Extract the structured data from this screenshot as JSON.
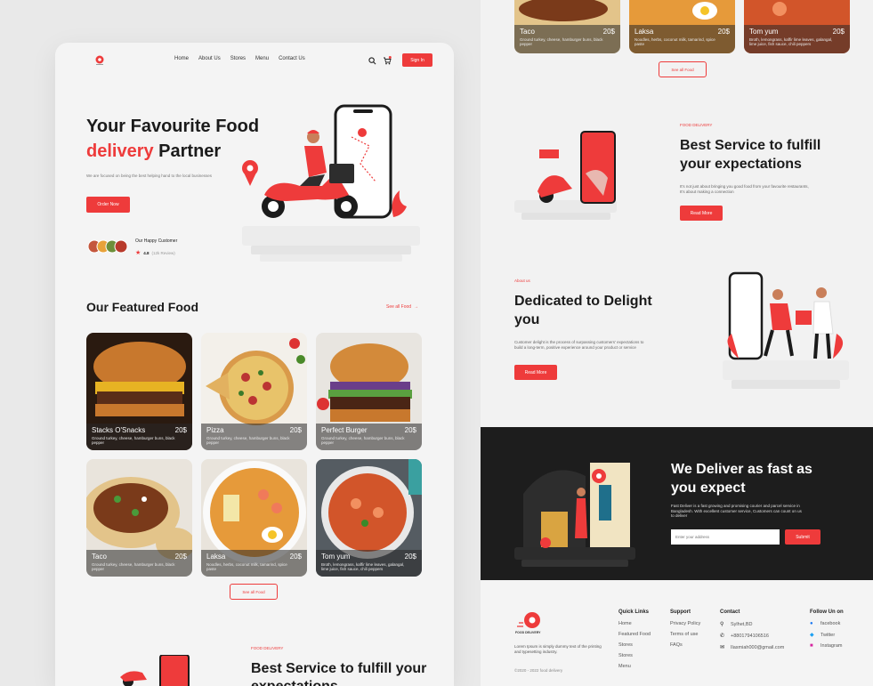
{
  "nav": {
    "links": [
      "Home",
      "About Us",
      "Stores",
      "Menu",
      "Contact Us"
    ],
    "signin": "Sign In"
  },
  "hero": {
    "title_line1": "Your Favourite Food",
    "title_red": "delivery",
    "title_rest": " Partner",
    "subtitle": "We are focused on being the best helping hand to the local businesses",
    "order_button": "Order Now",
    "customers_label": "Our Happy Customer",
    "rating": "4.8",
    "reviews": "(12k Review)"
  },
  "featured": {
    "title": "Our Featured Food",
    "see_all": "See all Food",
    "see_all_button": "See all Food",
    "items": [
      {
        "name": "Stacks O'Snacks",
        "price": "20$",
        "desc": "Ground turkey, cheese, hamburger buns, black pepper"
      },
      {
        "name": "Pizza",
        "price": "20$",
        "desc": "Ground turkey, cheese, hamburger buns, black pepper"
      },
      {
        "name": "Perfect Burger",
        "price": "20$",
        "desc": "Ground turkey, cheese, hamburger buns, black pepper"
      },
      {
        "name": "Taco",
        "price": "20$",
        "desc": "Ground turkey, cheese, hamburger buns, black pepper"
      },
      {
        "name": "Laksa",
        "price": "20$",
        "desc": "Noodles, herbs, coconut milk, tamarind, spice paste"
      },
      {
        "name": "Tom yum",
        "price": "20$",
        "desc": "Broth, lemongrass, kaffir lime leaves, galangal, lime juice, fish sauce, chili peppers"
      }
    ]
  },
  "left_service": {
    "tag": "FOOD DELIVERY",
    "title": "Best Service to fulfill your expectations"
  },
  "service": {
    "tag": "FOOD DELIVERY",
    "title": "Best Service to fulfill your expectations",
    "text": "It's not just about bringing you good food from your favourite restaurants, It's about making a connection",
    "button": "Read More"
  },
  "about": {
    "tag": "About us",
    "title": "Dedicated to Delight you",
    "text": "Customer delight is the process of surpassing customers' expectations to build a long-term, positive experience around your product or service",
    "button": "Read More"
  },
  "deliver": {
    "title": "We Deliver as fast as you expect",
    "text": "Fast Deliver is a fast growing and promising courier and parcel service in Bangladesh. With excellent customer service, Customers can count on us to deliver",
    "placeholder": "Enter your address",
    "submit": "Submit"
  },
  "footer": {
    "brand": "FOOD DELIVERY",
    "desc": "Lorem Ipsum is simply dummy text of the printing and typesetting industry.",
    "copyright": "©2020 - 2022 food delivery",
    "quick_links": {
      "head": "Quick Links",
      "items": [
        "Home",
        "Featured Food",
        "Stores",
        "Stores",
        "Menu"
      ]
    },
    "support": {
      "head": "Support",
      "items": [
        "Privacy Policy",
        "Terms of use",
        "FAQs"
      ]
    },
    "contact": {
      "head": "Contact",
      "items": [
        "Sylhet,BD",
        "+8801794106516",
        "Ilasmiah000@gmail.com"
      ]
    },
    "follow": {
      "head": "Follow Un on",
      "items": [
        "facebook",
        "Twitter",
        "Instagram"
      ]
    }
  },
  "colors": {
    "accent": "#ee3b3b",
    "dark": "#1d1d1d"
  }
}
